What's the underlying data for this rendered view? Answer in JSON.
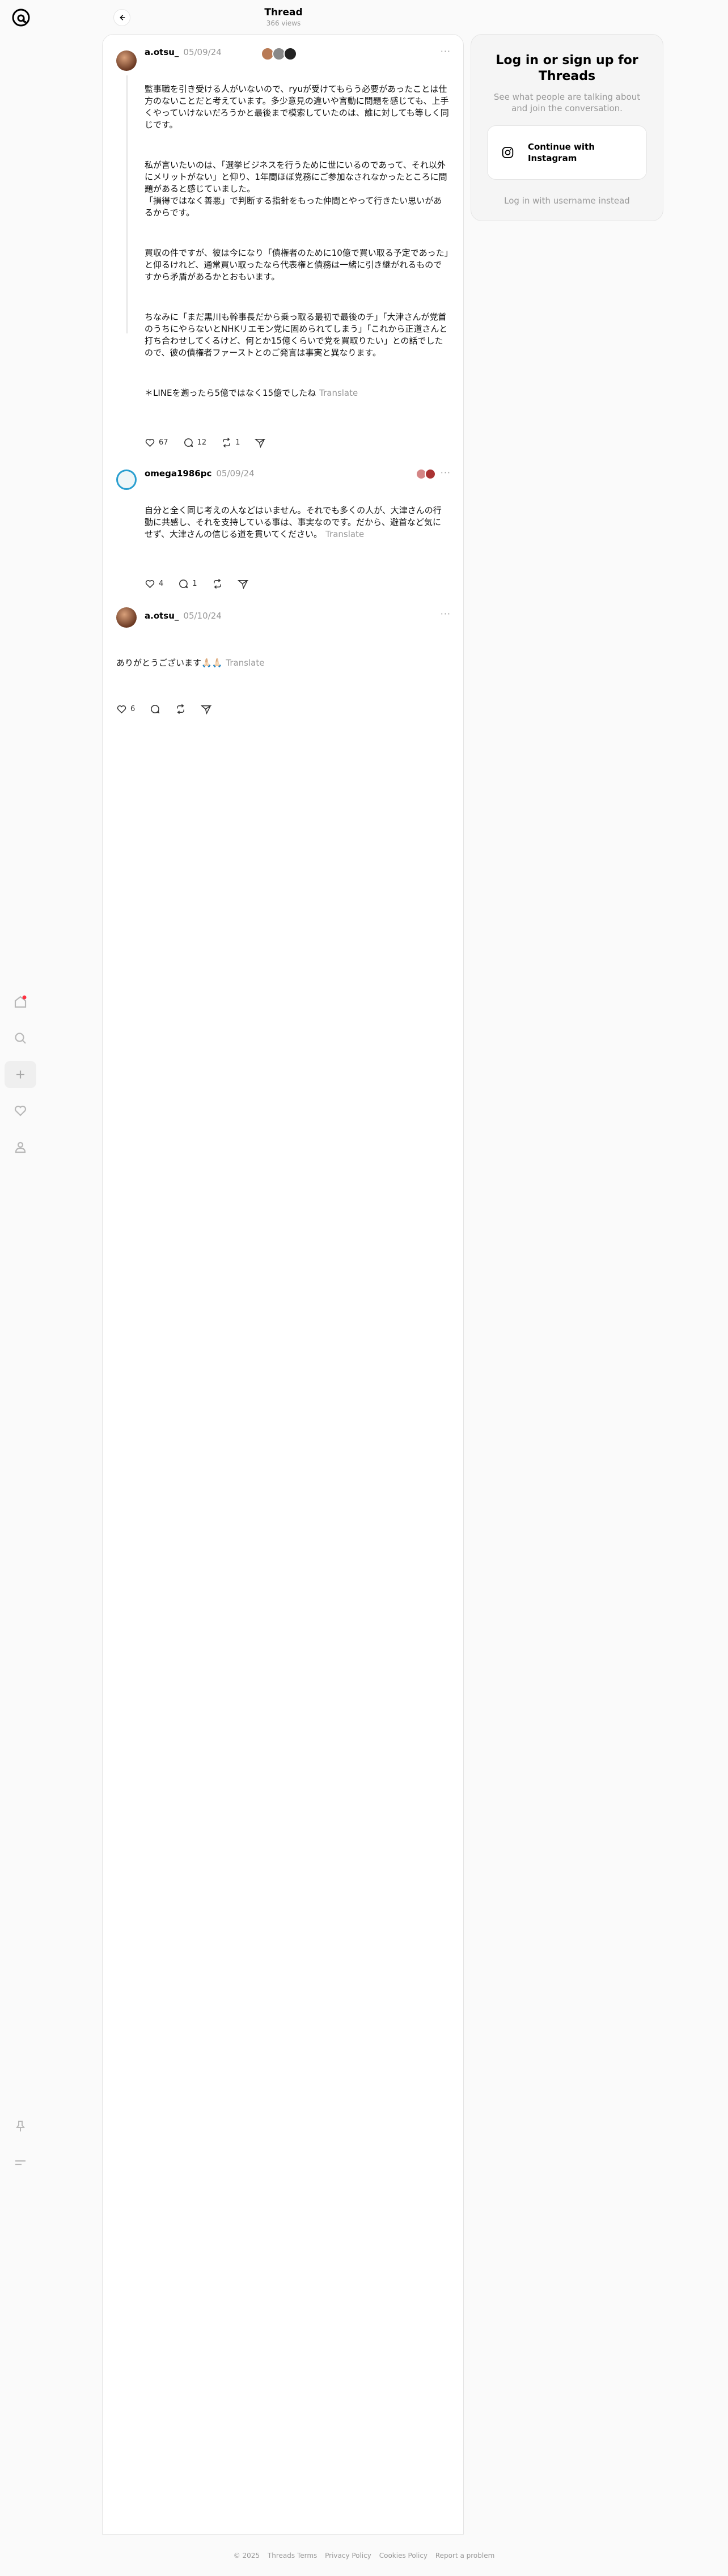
{
  "header": {
    "title": "Thread",
    "views": "366 views"
  },
  "posts": [
    {
      "username": "a.otsu_",
      "date": "05/09/24",
      "paragraphs": [
        "監事職を引き受ける人がいないので、ryuが受けてもらう必要があったことは仕方のないことだと考えています。多少意見の違いや言動に問題を感じても、上手くやっていけないだろうかと最後まで模索していたのは、誰に対しても等しく同じです。",
        "私が言いたいのは、「選挙ビジネスを行うために世にいるのであって、それ以外にメリットがない」と仰り、1年間ほぼ党務にご参加なされなかったところに問題があると感じていました。\n「損得ではなく善悪」で判断する指針をもった仲間とやって行きたい思いがあるからです。",
        "買収の件ですが、彼は今になり「債権者のために10億で買い取る予定であった」と仰るけれど、通常買い取ったなら代表権と債務は一緒に引き継がれるものですから矛盾があるかとおもいます。",
        "ちなみに「まだ黒川も幹事長だから乗っ取る最初で最後のチ」「大津さんが党首のうちにやらないとNHKリエモン党に固められてしまう」「これから正道さんと打ち合わせしてくるけど、何とか15億くらいで党を買取りたい」との話でしたので、彼の債権者ファーストとのご発言は事実と異なります。",
        "＊LINEを遡ったら5億ではなく15億でしたね"
      ],
      "translate": "Translate",
      "likes": "67",
      "replies": "12",
      "reposts": "1"
    },
    {
      "username": "omega1986pc",
      "date": "05/09/24",
      "paragraphs": [
        "自分と全く同じ考えの人などはいません。それでも多くの人が、大津さんの行動に共感し、それを支持している事は、事実なのです。だから、避首など気にせず、大津さんの信じる道を貫いてください。"
      ],
      "translate": "Translate",
      "likes": "4",
      "replies": "1",
      "reposts": ""
    },
    {
      "username": "a.otsu_",
      "date": "05/10/24",
      "paragraphs": [
        "ありがとうございます🙏🏻🙏🏻"
      ],
      "translate": "Translate",
      "likes": "6",
      "replies": "",
      "reposts": ""
    }
  ],
  "more_label": "···",
  "login": {
    "title": "Log in or sign up for Threads",
    "subtitle": "See what people are talking about and join the conversation.",
    "instagram_button": "Continue with Instagram",
    "username_link": "Log in with username instead"
  },
  "footer": {
    "copyright": "© 2025",
    "links": [
      "Threads Terms",
      "Privacy Policy",
      "Cookies Policy",
      "Report a problem"
    ]
  },
  "nav_icons": [
    "home-icon",
    "search-icon",
    "create-icon",
    "heart-icon",
    "profile-icon"
  ],
  "nav_bottom_icons": [
    "pin-icon",
    "menu-icon"
  ],
  "colors": {
    "notification_dot": "#ff3040",
    "omega_ring": "#2a9fd0",
    "muted_text": "#999999"
  }
}
